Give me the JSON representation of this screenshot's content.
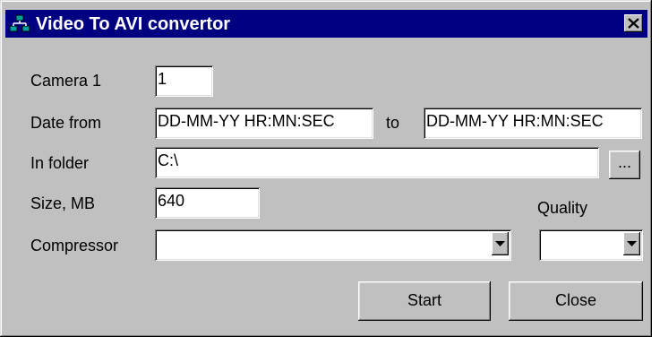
{
  "window": {
    "title": "Video To AVI convertor",
    "title_icon": "camera-network-icon",
    "close_icon": "close-icon"
  },
  "form": {
    "camera_label": "Camera 1",
    "camera_value": "1",
    "date_from_label": "Date from",
    "date_from_value": "DD-MM-YY HR:MN:SEC",
    "to_label": "to",
    "date_to_value": "DD-MM-YY HR:MN:SEC",
    "folder_label": "In folder",
    "folder_value": "C:\\",
    "browse_label": "...",
    "size_label": "Size, MB",
    "size_value": "640",
    "quality_label": "Quality",
    "quality_value": "",
    "compressor_label": "Compressor",
    "compressor_value": ""
  },
  "buttons": {
    "start_label": "Start",
    "close_label": "Close"
  }
}
